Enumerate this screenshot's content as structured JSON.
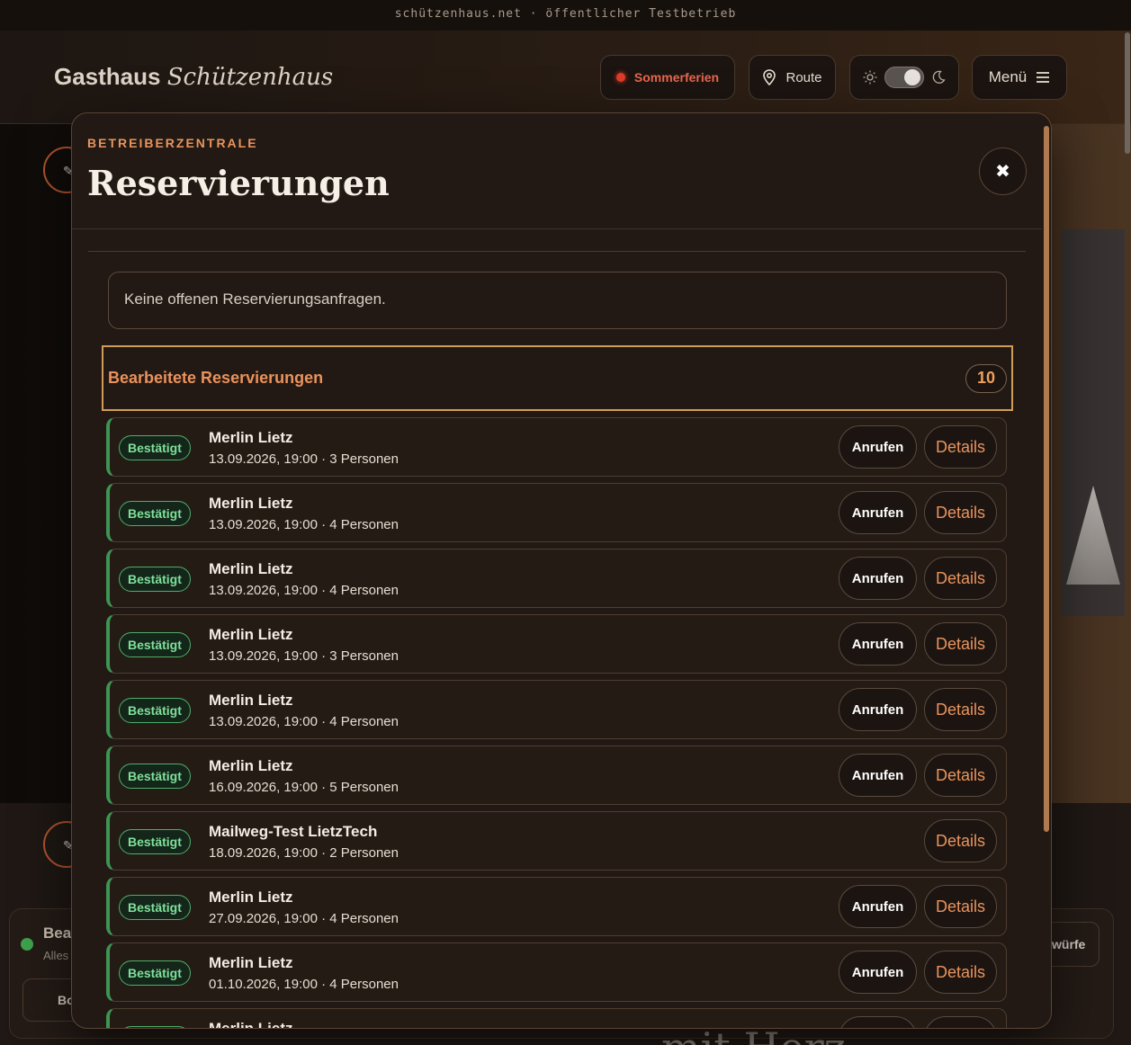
{
  "site": {
    "banner": "schützenhaus.net · öffentlicher Testbetrieb",
    "brand_plain": "Gasthaus",
    "brand_script": "Schützenhaus",
    "holiday_label": "Sommerferien",
    "route_label": "Route",
    "menu_label": "Menü",
    "bg_text_bea": "Bea",
    "bg_text_alles": "Alles",
    "bg_btn_bo": "Bo",
    "bg_btn_wurfe": "würfe",
    "bg_text_herz": "mit Herz"
  },
  "icons": {
    "holiday": "red-dot-icon",
    "route": "map-pin-icon",
    "light": "sun-icon",
    "dark": "moon-icon",
    "menu": "hamburger-icon",
    "close": "close-icon",
    "edit": "pencil-icon"
  },
  "colors": {
    "accent": "#e8945e",
    "confirmed": "#7fe09a",
    "holiday": "#e03b2a",
    "modal_bg": "#221914"
  },
  "modal": {
    "kicker": "BETREIBERZENTRALE",
    "title": "Reservierungen",
    "empty_message": "Keine offenen Reservierungsanfragen.",
    "section_title": "Bearbeitete Reservierungen",
    "section_count": "10",
    "call_label": "Anrufen",
    "details_label": "Details",
    "reservations": [
      {
        "status": "Bestätigt",
        "name": "Merlin Lietz",
        "meta": "13.09.2026, 19:00 · 3 Personen",
        "has_call": true
      },
      {
        "status": "Bestätigt",
        "name": "Merlin Lietz",
        "meta": "13.09.2026, 19:00 · 4 Personen",
        "has_call": true
      },
      {
        "status": "Bestätigt",
        "name": "Merlin Lietz",
        "meta": "13.09.2026, 19:00 · 4 Personen",
        "has_call": true
      },
      {
        "status": "Bestätigt",
        "name": "Merlin Lietz",
        "meta": "13.09.2026, 19:00 · 3 Personen",
        "has_call": true
      },
      {
        "status": "Bestätigt",
        "name": "Merlin Lietz",
        "meta": "13.09.2026, 19:00 · 4 Personen",
        "has_call": true
      },
      {
        "status": "Bestätigt",
        "name": "Merlin Lietz",
        "meta": "16.09.2026, 19:00 · 5 Personen",
        "has_call": true
      },
      {
        "status": "Bestätigt",
        "name": "Mailweg-Test LietzTech",
        "meta": "18.09.2026, 19:00 · 2 Personen",
        "has_call": false
      },
      {
        "status": "Bestätigt",
        "name": "Merlin Lietz",
        "meta": "27.09.2026, 19:00 · 4 Personen",
        "has_call": true
      },
      {
        "status": "Bestätigt",
        "name": "Merlin Lietz",
        "meta": "01.10.2026, 19:00 · 4 Personen",
        "has_call": true
      },
      {
        "status": "Bestätigt",
        "name": "Merlin Lietz",
        "meta": "",
        "has_call": true
      }
    ]
  }
}
